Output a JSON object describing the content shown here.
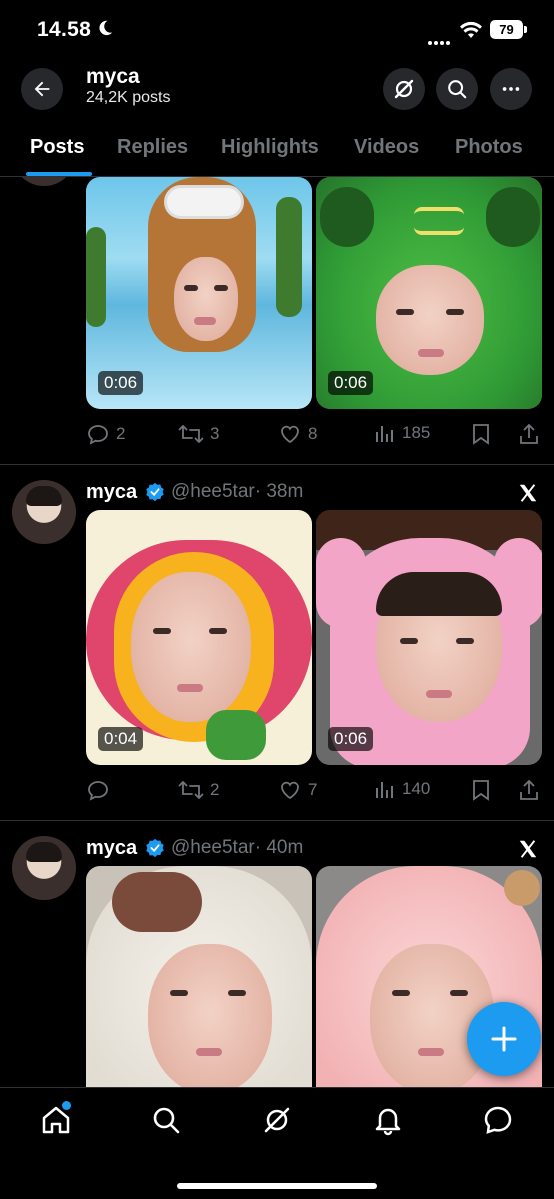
{
  "status_bar": {
    "time": "14.58",
    "battery": "79"
  },
  "header": {
    "title": "myca",
    "subtitle": "24,2K posts"
  },
  "tabs": [
    {
      "label": "Posts",
      "active": true
    },
    {
      "label": "Replies",
      "active": false
    },
    {
      "label": "Highlights",
      "active": false
    },
    {
      "label": "Videos",
      "active": false
    },
    {
      "label": "Photos",
      "active": false
    }
  ],
  "posts": [
    {
      "media": [
        {
          "duration": "0:06",
          "theme": "dog-mask"
        },
        {
          "duration": "0:06",
          "theme": "grasshopper-mask"
        }
      ],
      "replies": "2",
      "reposts": "3",
      "likes": "8",
      "views": "185"
    },
    {
      "name": "myca",
      "handle": "@hee5tar",
      "time": "· 38m",
      "media": [
        {
          "duration": "0:04",
          "theme": "flower-mask"
        },
        {
          "duration": "0:06",
          "theme": "pink-bear-mask"
        }
      ],
      "replies": "",
      "reposts": "2",
      "likes": "7",
      "views": "140"
    },
    {
      "name": "myca",
      "handle": "@hee5tar",
      "time": "· 40m",
      "media": [
        {
          "duration": "",
          "theme": "white-mochi-mask"
        },
        {
          "duration": "",
          "theme": "pink-mochi-mask"
        }
      ]
    }
  ],
  "icons": {
    "back": "arrow-left-icon",
    "grok": "grok-icon",
    "search": "search-icon",
    "more": "more-icon",
    "verified": "verified-badge-icon",
    "x": "x-logo-icon",
    "reply": "reply-icon",
    "repost": "repost-icon",
    "like": "heart-icon",
    "views": "views-icon",
    "bookmark": "bookmark-icon",
    "share": "share-icon",
    "compose": "compose-plus-icon",
    "home": "home-icon",
    "explore": "search-icon",
    "grok_nav": "grok-icon",
    "notifications": "bell-icon",
    "messages": "message-icon"
  },
  "colors": {
    "accent": "#1d9bf0",
    "background": "#000000",
    "muted": "#71767b"
  }
}
